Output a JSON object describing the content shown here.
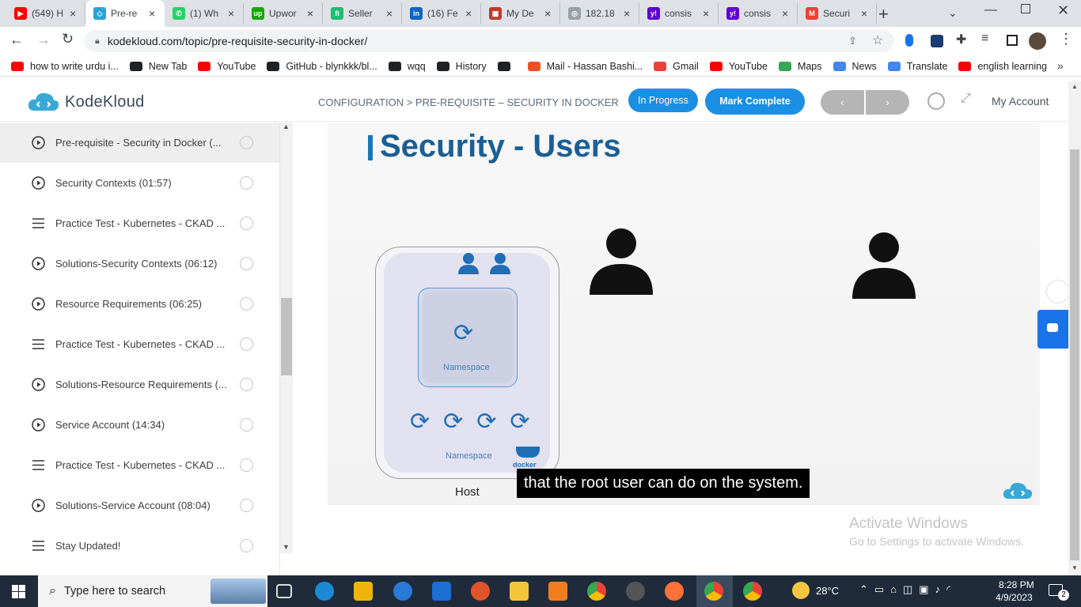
{
  "browser": {
    "tabs": [
      {
        "title": "(549) H",
        "color": "#ff0000",
        "glyph": "▶"
      },
      {
        "title": "Pre-re",
        "color": "#29a3d8",
        "glyph": "◇",
        "active": true
      },
      {
        "title": "(1) Wh",
        "color": "#25d366",
        "glyph": "✆"
      },
      {
        "title": "Upwor",
        "color": "#14a800",
        "glyph": "up"
      },
      {
        "title": "Seller",
        "color": "#1dbf73",
        "glyph": "fi"
      },
      {
        "title": "(16) Fe",
        "color": "#0a66c2",
        "glyph": "in"
      },
      {
        "title": "My De",
        "color": "#c0392b",
        "glyph": "▦"
      },
      {
        "title": "182.18",
        "color": "#9aa0a6",
        "glyph": "◎"
      },
      {
        "title": "consis",
        "color": "#6001d2",
        "glyph": "y!"
      },
      {
        "title": "consis",
        "color": "#6001d2",
        "glyph": "y!"
      },
      {
        "title": "Securi",
        "color": "#ea4335",
        "glyph": "M"
      }
    ],
    "url": "kodekloud.com/topic/pre-requisite-security-in-docker/",
    "bookmarks": [
      {
        "label": "how to write urdu i...",
        "color": "#ff0000"
      },
      {
        "label": "New Tab",
        "color": "#202124"
      },
      {
        "label": "YouTube",
        "color": "#ff0000"
      },
      {
        "label": "GitHub - blynkkk/bl...",
        "color": "#202124"
      },
      {
        "label": "wqq",
        "color": "#202124"
      },
      {
        "label": "History",
        "color": "#202124"
      },
      {
        "label": "",
        "color": "#202124"
      },
      {
        "label": "Mail - Hassan Bashi...",
        "color": "#f25022"
      },
      {
        "label": "Gmail",
        "color": "#ea4335"
      },
      {
        "label": "YouTube",
        "color": "#ff0000"
      },
      {
        "label": "Maps",
        "color": "#34a853"
      },
      {
        "label": "News",
        "color": "#4285f4"
      },
      {
        "label": "Translate",
        "color": "#4285f4"
      },
      {
        "label": "english learning",
        "color": "#ff0000"
      }
    ]
  },
  "app": {
    "logo_text": "KodeKloud",
    "breadcrumb": "CONFIGURATION > PRE-REQUISITE – SECURITY IN DOCKER",
    "status_badge": "In Progress",
    "mark_complete": "Mark Complete",
    "account": "My Account"
  },
  "sidebar": {
    "lessons": [
      {
        "label": "Pre-requisite - Security in Docker (...",
        "type": "video",
        "active": true
      },
      {
        "label": "Security Contexts (01:57)",
        "type": "video"
      },
      {
        "label": "Practice Test - Kubernetes - CKAD ...",
        "type": "lab"
      },
      {
        "label": "Solutions-Security Contexts (06:12)",
        "type": "video"
      },
      {
        "label": "Resource Requirements (06:25)",
        "type": "video"
      },
      {
        "label": "Practice Test - Kubernetes - CKAD ...",
        "type": "lab"
      },
      {
        "label": "Solutions-Resource Requirements (...",
        "type": "video"
      },
      {
        "label": "Service Account (14:34)",
        "type": "video"
      },
      {
        "label": "Practice Test - Kubernetes - CKAD ...",
        "type": "lab"
      },
      {
        "label": "Solutions-Service Account (08:04)",
        "type": "video"
      },
      {
        "label": "Stay Updated!",
        "type": "lab"
      }
    ]
  },
  "video": {
    "slide_title": "Security - Users",
    "namespace_inner": "Namespace",
    "namespace_outer": "Namespace",
    "docker_label": "docker",
    "host_label": "Host",
    "caption": "that the root user can do on the system."
  },
  "watermark": {
    "line1": "Activate Windows",
    "line2": "Go to Settings to activate Windows."
  },
  "taskbar": {
    "search_placeholder": "Type here to search",
    "weather": "28°C",
    "time": "8:28 PM",
    "date": "4/9/2023",
    "notifications": "2"
  }
}
